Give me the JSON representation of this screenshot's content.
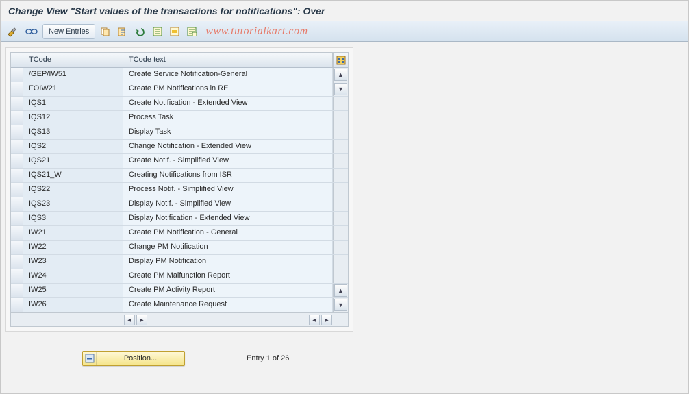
{
  "title": "Change View \"Start values of the transactions for notifications\": Over",
  "toolbar": {
    "new_entries_label": "New Entries"
  },
  "watermark": "www.tutorialkart.com",
  "grid": {
    "columns": {
      "tcode": "TCode",
      "text": "TCode text"
    },
    "rows": [
      {
        "tcode": "/GEP/IW51",
        "text": "Create Service Notification-General"
      },
      {
        "tcode": "FOIW21",
        "text": "Create PM Notifications in RE"
      },
      {
        "tcode": "IQS1",
        "text": "Create Notification - Extended View"
      },
      {
        "tcode": "IQS12",
        "text": "Process Task"
      },
      {
        "tcode": "IQS13",
        "text": "Display Task"
      },
      {
        "tcode": "IQS2",
        "text": "Change Notification - Extended View"
      },
      {
        "tcode": "IQS21",
        "text": "Create Notif. - Simplified View"
      },
      {
        "tcode": "IQS21_W",
        "text": "Creating Notifications from ISR"
      },
      {
        "tcode": "IQS22",
        "text": "Process Notif. - Simplified View"
      },
      {
        "tcode": "IQS23",
        "text": "Display Notif. - Simplified View"
      },
      {
        "tcode": "IQS3",
        "text": "Display Notification - Extended View"
      },
      {
        "tcode": "IW21",
        "text": "Create PM Notification - General"
      },
      {
        "tcode": "IW22",
        "text": "Change PM Notification"
      },
      {
        "tcode": "IW23",
        "text": "Display PM Notification"
      },
      {
        "tcode": "IW24",
        "text": "Create PM Malfunction Report"
      },
      {
        "tcode": "IW25",
        "text": "Create PM Activity Report"
      },
      {
        "tcode": "IW26",
        "text": "Create Maintenance Request"
      }
    ]
  },
  "footer": {
    "position_label": "Position...",
    "entry_count": "Entry 1 of 26"
  },
  "icons": {
    "toggle": "toggle-display-change-icon",
    "glasses": "other-view-icon",
    "copy": "copy-icon",
    "copy_entry": "copy-as-icon",
    "undo": "undo-icon",
    "select_all": "select-all-icon",
    "select_block": "select-block-icon",
    "deselect_all": "deselect-all-icon",
    "table_settings": "table-settings-icon",
    "position_icon": "table-position-icon"
  }
}
